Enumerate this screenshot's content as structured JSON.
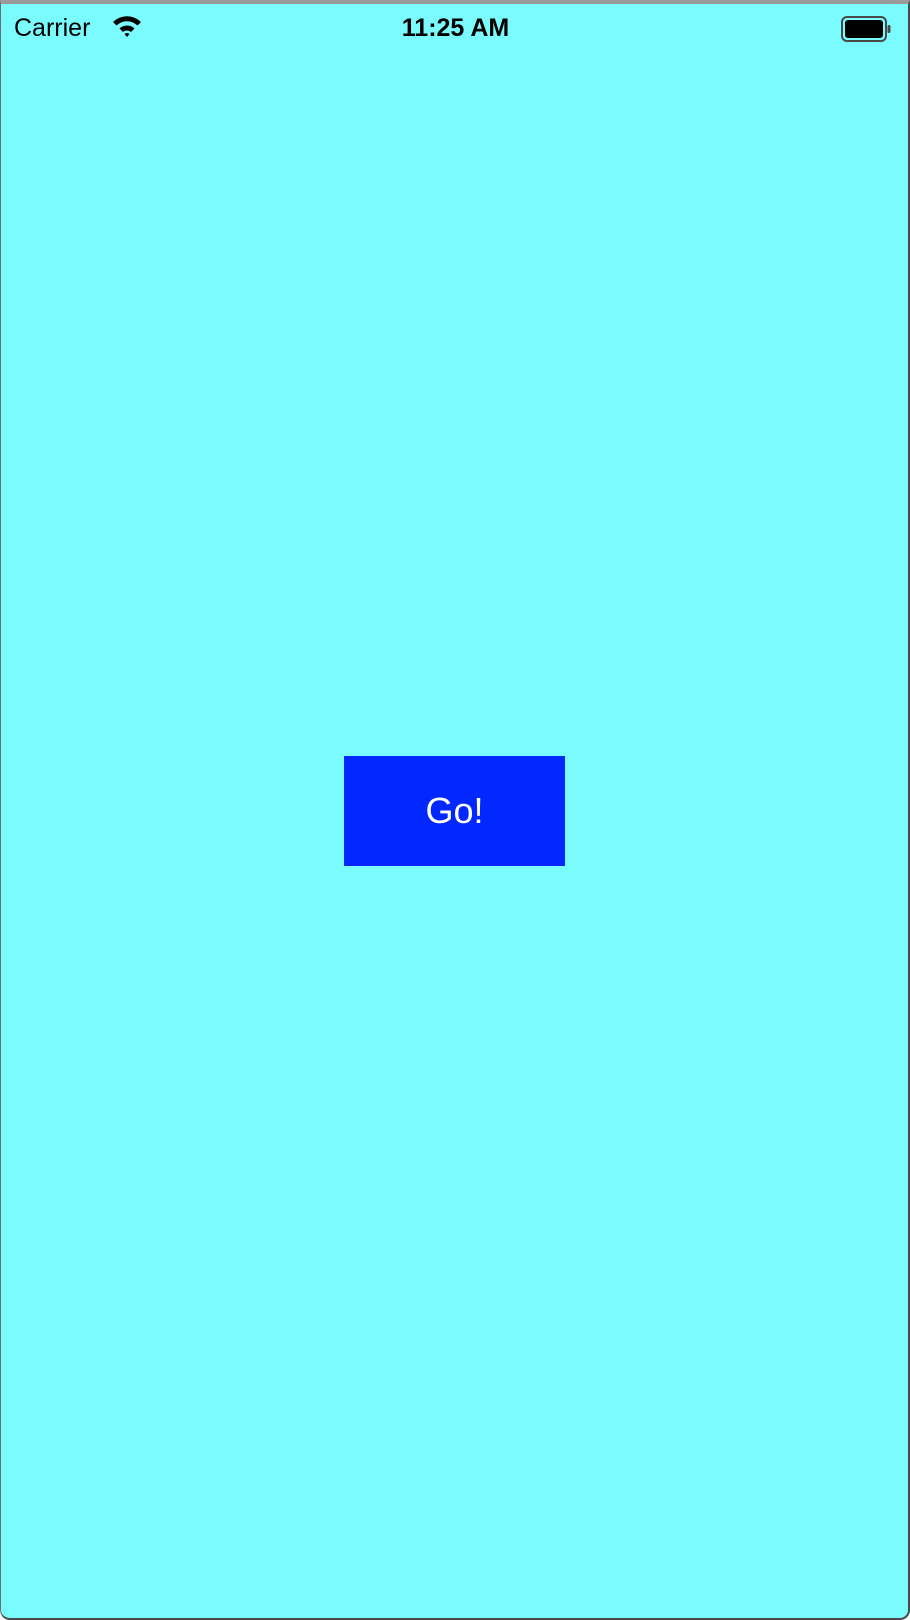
{
  "status_bar": {
    "carrier": "Carrier",
    "time": "11:25 AM",
    "wifi_icon": "wifi-icon",
    "battery_icon": "battery-icon"
  },
  "main": {
    "button_label": "Go!"
  },
  "colors": {
    "background": "#7afcfe",
    "button": "#0227ff",
    "button_text": "#ffffff"
  }
}
